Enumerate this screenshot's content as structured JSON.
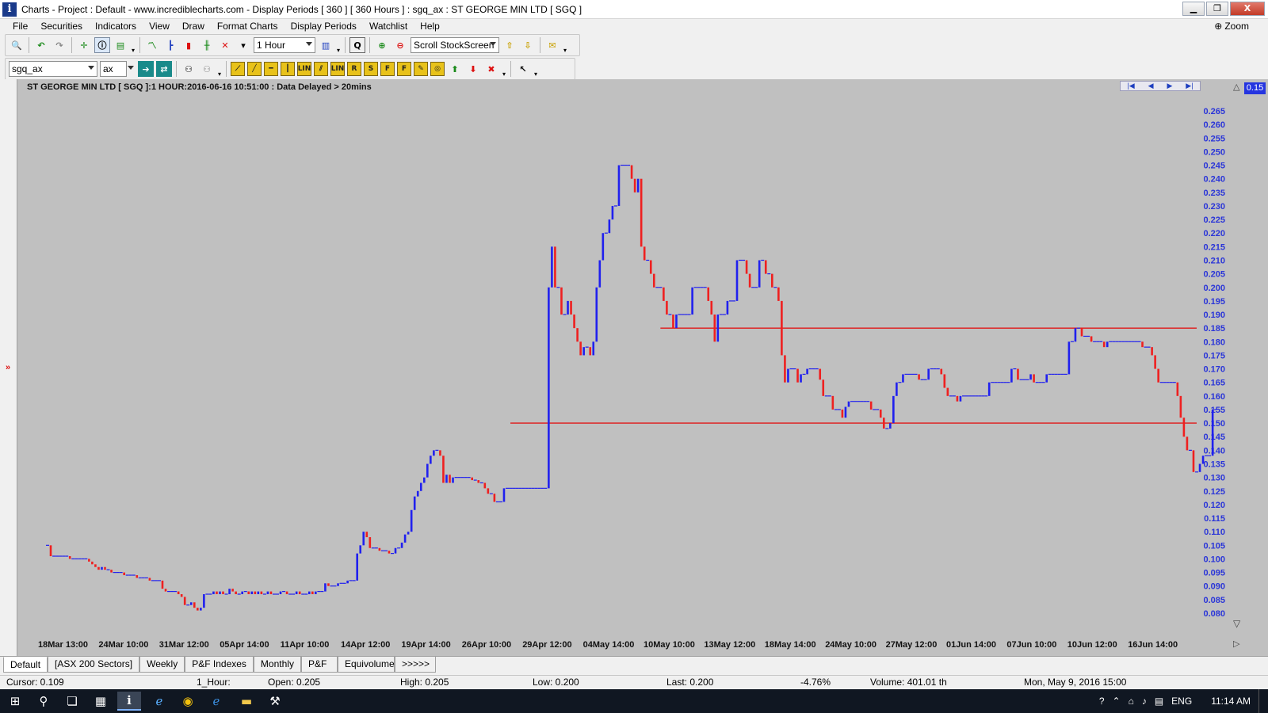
{
  "window": {
    "title": "Charts - Project : Default - www.incrediblecharts.com - Display Periods  [ 360 ]  [ 360 Hours ] : sgq_ax : ST GEORGE MIN LTD  [ SGQ ]",
    "app_icon": "i",
    "controls": {
      "minimize": "▁",
      "maximize": "❐",
      "close": "X"
    }
  },
  "menu": {
    "items": [
      "File",
      "Securities",
      "Indicators",
      "View",
      "Draw",
      "Format Charts",
      "Display Periods",
      "Watchlist",
      "Help"
    ],
    "zoom_label": "Zoom"
  },
  "toolbar1": {
    "period_select": "1 Hour",
    "scroll_select": "Scroll StockScreen",
    "icons": [
      "search-icon",
      "undo-icon",
      "redo-icon",
      "crosshair-icon",
      "info-icon",
      "table-icon",
      "line-chart-icon",
      "bar-chart-icon",
      "candle-icon",
      "point-figure-icon",
      "ohlc-icon",
      "q-icon",
      "add-security-icon",
      "remove-security-icon",
      "arrow-up-icon",
      "arrow-down-icon",
      "mail-icon"
    ]
  },
  "toolbar2": {
    "security_input": "sgq_ax",
    "exchange_select": "ax",
    "draw_tools": [
      "trend",
      "line",
      "horiz",
      "vert",
      "LIN",
      "para",
      "LIN",
      "R",
      "S",
      "F",
      "F",
      "note",
      "cycle",
      "arrow-up",
      "arrow-down",
      "delete"
    ]
  },
  "chart": {
    "header": "ST GEORGE MIN LTD [ SGQ ]:1 HOUR:2016-06-16 10:51:00 : Data Delayed > 20mins",
    "scale_badge": "0.15",
    "nav": [
      "|◀",
      "◀",
      "▶",
      "▶|"
    ]
  },
  "chart_data": {
    "type": "bar",
    "title": "ST GEORGE MIN LTD [ SGQ ]:1 HOUR:2016-06-16 10:51:00 : Data Delayed > 20mins",
    "ylim": [
      0.08,
      0.265
    ],
    "y_ticks": [
      "0.265",
      "0.260",
      "0.255",
      "0.250",
      "0.245",
      "0.240",
      "0.235",
      "0.230",
      "0.225",
      "0.220",
      "0.215",
      "0.210",
      "0.205",
      "0.200",
      "0.195",
      "0.190",
      "0.185",
      "0.180",
      "0.175",
      "0.170",
      "0.165",
      "0.160",
      "0.155",
      "0.150",
      "0.145",
      "0.140",
      "0.135",
      "0.130",
      "0.125",
      "0.120",
      "0.115",
      "0.110",
      "0.105",
      "0.100",
      "0.095",
      "0.090",
      "0.085",
      "0.080"
    ],
    "x_labels": [
      "18Mar 13:00",
      "24Mar 10:00",
      "31Mar 12:00",
      "05Apr 14:00",
      "11Apr 10:00",
      "14Apr 12:00",
      "19Apr 14:00",
      "26Apr 10:00",
      "29Apr 12:00",
      "04May 14:00",
      "10May 10:00",
      "13May 12:00",
      "18May 14:00",
      "24May 10:00",
      "27May 12:00",
      "01Jun 14:00",
      "07Jun 10:00",
      "10Jun 12:00",
      "16Jun 14:00"
    ],
    "up_color": "#2020ee",
    "down_color": "#ee2020",
    "horizontal_lines": [
      {
        "value": 0.185,
        "from_bar": 192,
        "to_bar": 359
      },
      {
        "value": 0.15,
        "from_bar": 145,
        "to_bar": 359
      }
    ],
    "series": [
      {
        "values": [
          0.105,
          0.101,
          0.101,
          0.101,
          0.101,
          0.101,
          0.101,
          0.1,
          0.1,
          0.1,
          0.1,
          0.1,
          0.1,
          0.099,
          0.098,
          0.097,
          0.096,
          0.097,
          0.096,
          0.096,
          0.095,
          0.095,
          0.095,
          0.095,
          0.094,
          0.094,
          0.094,
          0.094,
          0.093,
          0.093,
          0.093,
          0.093,
          0.092,
          0.092,
          0.092,
          0.092,
          0.089,
          0.088,
          0.088,
          0.088,
          0.088,
          0.087,
          0.086,
          0.083,
          0.083,
          0.084,
          0.082,
          0.081,
          0.082,
          0.087,
          0.087,
          0.087,
          0.088,
          0.087,
          0.088,
          0.087,
          0.087,
          0.089,
          0.088,
          0.087,
          0.087,
          0.088,
          0.088,
          0.087,
          0.088,
          0.087,
          0.088,
          0.087,
          0.087,
          0.088,
          0.087,
          0.087,
          0.087,
          0.088,
          0.088,
          0.087,
          0.087,
          0.087,
          0.088,
          0.087,
          0.087,
          0.087,
          0.088,
          0.087,
          0.088,
          0.088,
          0.088,
          0.091,
          0.09,
          0.09,
          0.09,
          0.091,
          0.091,
          0.091,
          0.092,
          0.092,
          0.092,
          0.102,
          0.105,
          0.11,
          0.108,
          0.104,
          0.104,
          0.104,
          0.103,
          0.103,
          0.103,
          0.102,
          0.102,
          0.104,
          0.104,
          0.106,
          0.109,
          0.11,
          0.118,
          0.123,
          0.125,
          0.128,
          0.13,
          0.135,
          0.138,
          0.14,
          0.14,
          0.138,
          0.128,
          0.131,
          0.128,
          0.13,
          0.13,
          0.13,
          0.13,
          0.13,
          0.13,
          0.129,
          0.129,
          0.128,
          0.128,
          0.126,
          0.124,
          0.124,
          0.121,
          0.121,
          0.121,
          0.126,
          0.126,
          0.126,
          0.126,
          0.126,
          0.126,
          0.126,
          0.126,
          0.126,
          0.126,
          0.126,
          0.126,
          0.126,
          0.126,
          0.2,
          0.215,
          0.2,
          0.2,
          0.19,
          0.19,
          0.195,
          0.19,
          0.185,
          0.18,
          0.175,
          0.178,
          0.178,
          0.175,
          0.18,
          0.2,
          0.21,
          0.22,
          0.22,
          0.225,
          0.23,
          0.23,
          0.245,
          0.245,
          0.245,
          0.245,
          0.24,
          0.235,
          0.24,
          0.215,
          0.21,
          0.21,
          0.205,
          0.2,
          0.2,
          0.2,
          0.195,
          0.19,
          0.19,
          0.185,
          0.19,
          0.19,
          0.19,
          0.19,
          0.19,
          0.2,
          0.2,
          0.2,
          0.2,
          0.2,
          0.195,
          0.19,
          0.18,
          0.19,
          0.19,
          0.19,
          0.195,
          0.195,
          0.195,
          0.21,
          0.21,
          0.21,
          0.205,
          0.2,
          0.2,
          0.2,
          0.21,
          0.21,
          0.205,
          0.205,
          0.2,
          0.2,
          0.195,
          0.175,
          0.165,
          0.17,
          0.17,
          0.17,
          0.165,
          0.168,
          0.168,
          0.17,
          0.17,
          0.17,
          0.17,
          0.166,
          0.16,
          0.16,
          0.16,
          0.155,
          0.155,
          0.155,
          0.152,
          0.156,
          0.158,
          0.158,
          0.158,
          0.158,
          0.158,
          0.158,
          0.158,
          0.155,
          0.155,
          0.155,
          0.152,
          0.148,
          0.148,
          0.15,
          0.16,
          0.165,
          0.165,
          0.168,
          0.168,
          0.168,
          0.168,
          0.168,
          0.166,
          0.166,
          0.166,
          0.17,
          0.17,
          0.17,
          0.17,
          0.168,
          0.163,
          0.16,
          0.16,
          0.16,
          0.158,
          0.16,
          0.16,
          0.16,
          0.16,
          0.16,
          0.16,
          0.16,
          0.16,
          0.16,
          0.165,
          0.165,
          0.165,
          0.165,
          0.165,
          0.165,
          0.165,
          0.17,
          0.17,
          0.166,
          0.166,
          0.166,
          0.166,
          0.168,
          0.165,
          0.165,
          0.165,
          0.165,
          0.168,
          0.168,
          0.168,
          0.168,
          0.168,
          0.168,
          0.168,
          0.18,
          0.18,
          0.185,
          0.185,
          0.182,
          0.182,
          0.182,
          0.18,
          0.18,
          0.18,
          0.18,
          0.178,
          0.18,
          0.18,
          0.18,
          0.18,
          0.18,
          0.18,
          0.18,
          0.18,
          0.18,
          0.18,
          0.18,
          0.178,
          0.178,
          0.178,
          0.175,
          0.17,
          0.165,
          0.165,
          0.165,
          0.165,
          0.165,
          0.165,
          0.16,
          0.152,
          0.145,
          0.14,
          0.14,
          0.132,
          0.132,
          0.135,
          0.138,
          0.138,
          0.138,
          0.155,
          0.155
        ]
      }
    ]
  },
  "tabs": [
    "Default",
    "[ASX 200 Sectors]",
    "Weekly",
    "P&F Indexes",
    "Monthly",
    "P&F",
    "Equivolume",
    ">>>>>"
  ],
  "status": {
    "cursor": "Cursor: 0.109",
    "period": "1_Hour:",
    "open": "Open: 0.205",
    "high": "High: 0.205",
    "low": "Low: 0.200",
    "last": "Last: 0.200",
    "change": "-4.76%",
    "volume": "Volume: 401.01 th",
    "date": "Mon, May 9, 2016 15:00"
  },
  "taskbar": {
    "apps": [
      "start-icon",
      "search-icon",
      "task-view-icon",
      "calculator-icon",
      "incredible-charts-icon",
      "ie-icon",
      "chrome-icon",
      "edge-icon",
      "explorer-icon",
      "tool-icon"
    ],
    "tray": {
      "language": "ENG",
      "time": "11:14 AM"
    }
  }
}
